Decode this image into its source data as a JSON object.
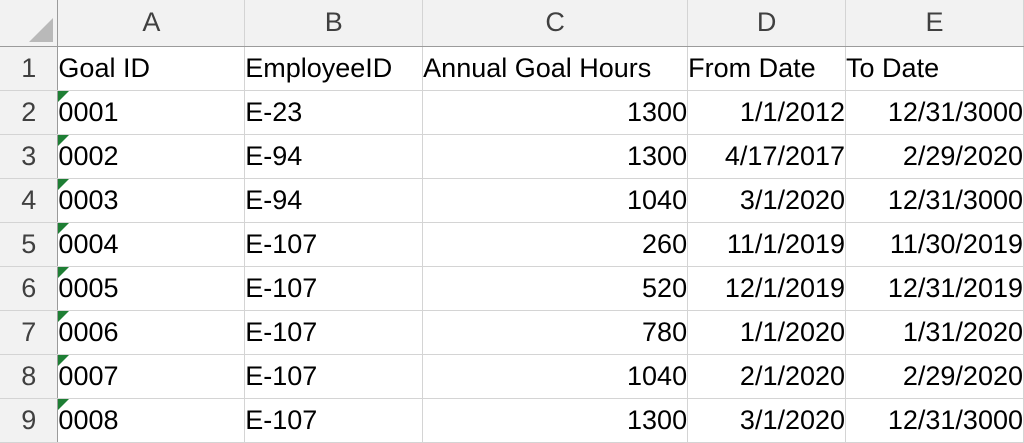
{
  "columns": [
    "A",
    "B",
    "C",
    "D",
    "E"
  ],
  "rows": [
    {
      "num": "1",
      "cells": [
        "Goal ID",
        "EmployeeID",
        "Annual Goal Hours",
        "From Date",
        "To Date"
      ]
    },
    {
      "num": "2",
      "cells": [
        "0001",
        "E-23",
        "1300",
        "1/1/2012",
        "12/31/3000"
      ]
    },
    {
      "num": "3",
      "cells": [
        "0002",
        "E-94",
        "1300",
        "4/17/2017",
        "2/29/2020"
      ]
    },
    {
      "num": "4",
      "cells": [
        "0003",
        "E-94",
        "1040",
        "3/1/2020",
        "12/31/3000"
      ]
    },
    {
      "num": "5",
      "cells": [
        "0004",
        "E-107",
        "260",
        "11/1/2019",
        "11/30/2019"
      ]
    },
    {
      "num": "6",
      "cells": [
        "0005",
        "E-107",
        "520",
        "12/1/2019",
        "12/31/2019"
      ]
    },
    {
      "num": "7",
      "cells": [
        "0006",
        "E-107",
        "780",
        "1/1/2020",
        "1/31/2020"
      ]
    },
    {
      "num": "8",
      "cells": [
        "0007",
        "E-107",
        "1040",
        "2/1/2020",
        "2/29/2020"
      ]
    },
    {
      "num": "9",
      "cells": [
        "0008",
        "E-107",
        "1300",
        "3/1/2020",
        "12/31/3000"
      ]
    }
  ],
  "colors": {
    "header_bg": "#f2f2f2",
    "gridline": "#d4d4d4",
    "header_border": "#9b9b9b",
    "error_flag": "#1e7e34"
  },
  "icons": {
    "select_all": "select-all-triangle-icon",
    "cell_flag": "number-stored-as-text-indicator-icon"
  }
}
